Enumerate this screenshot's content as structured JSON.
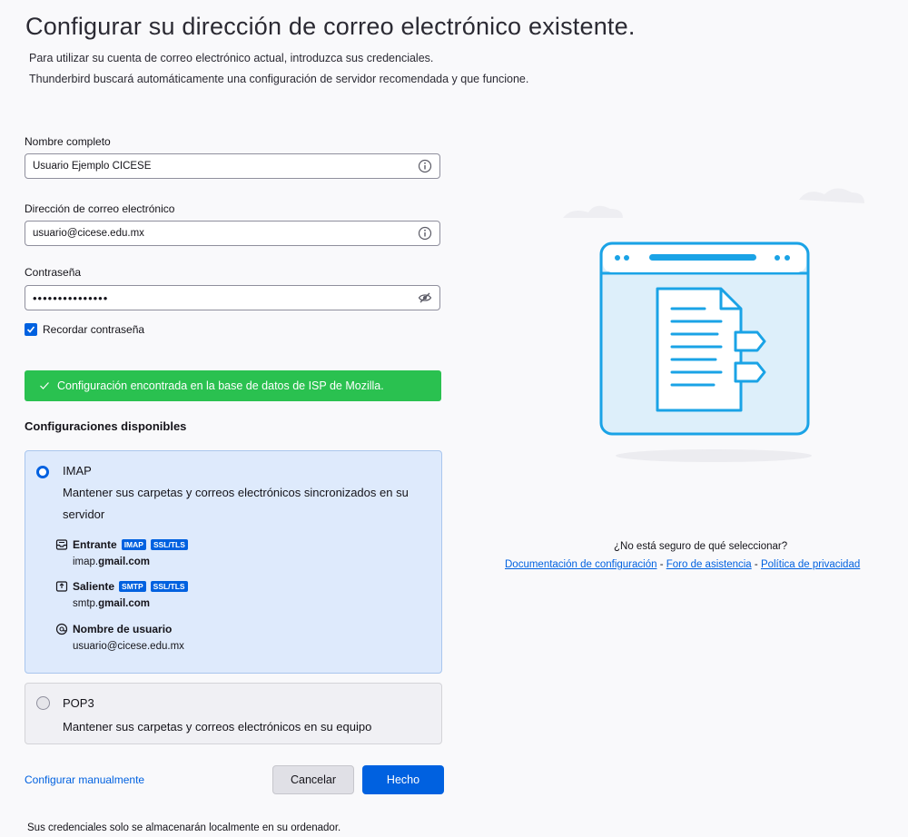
{
  "header": {
    "title": "Configurar su dirección de correo electrónico existente.",
    "description_line1": "Para utilizar su cuenta de correo electrónico actual, introduzca sus credenciales.",
    "description_line2": "Thunderbird buscará automáticamente una configuración de servidor recomendada y que funcione."
  },
  "form": {
    "fullname_label": "Nombre completo",
    "fullname_value": "Usuario Ejemplo CICESE",
    "email_label": "Dirección de correo electrónico",
    "email_value": "usuario@cicese.edu.mx",
    "password_label": "Contraseña",
    "password_value": "•••••••••••••••",
    "remember_label": "Recordar contraseña",
    "remember_checked": true
  },
  "status": {
    "message": "Configuración encontrada en la base de datos de ISP de Mozilla.",
    "color": "#2ac150"
  },
  "configs": {
    "heading": "Configuraciones disponibles",
    "imap": {
      "name": "IMAP",
      "description": "Mantener sus carpetas y correos electrónicos sincronizados en su servidor",
      "selected": true,
      "incoming_label": "Entrante",
      "incoming_tags": [
        "IMAP",
        "SSL/TLS"
      ],
      "incoming_host_prefix": "imap.",
      "incoming_host_domain": "gmail.com",
      "outgoing_label": "Saliente",
      "outgoing_tags": [
        "SMTP",
        "SSL/TLS"
      ],
      "outgoing_host_prefix": "smtp.",
      "outgoing_host_domain": "gmail.com",
      "username_label": "Nombre de usuario",
      "username_value": "usuario@cicese.edu.mx"
    },
    "pop3": {
      "name": "POP3",
      "description": "Mantener sus carpetas y correos electrónicos en su equipo",
      "selected": false
    }
  },
  "actions": {
    "manual_link": "Configurar manualmente",
    "cancel": "Cancelar",
    "done": "Hecho"
  },
  "footer": "Sus credenciales solo se almacenarán localmente en su ordenador.",
  "help": {
    "question": "¿No está seguro de qué seleccionar?",
    "doc_link": "Documentación de configuración",
    "forum_link": "Foro de asistencia",
    "privacy_link": "Política de privacidad",
    "separator": " - "
  },
  "colors": {
    "accent": "#0061e0",
    "success": "#2ac150",
    "selected_card": "#deeafc"
  }
}
